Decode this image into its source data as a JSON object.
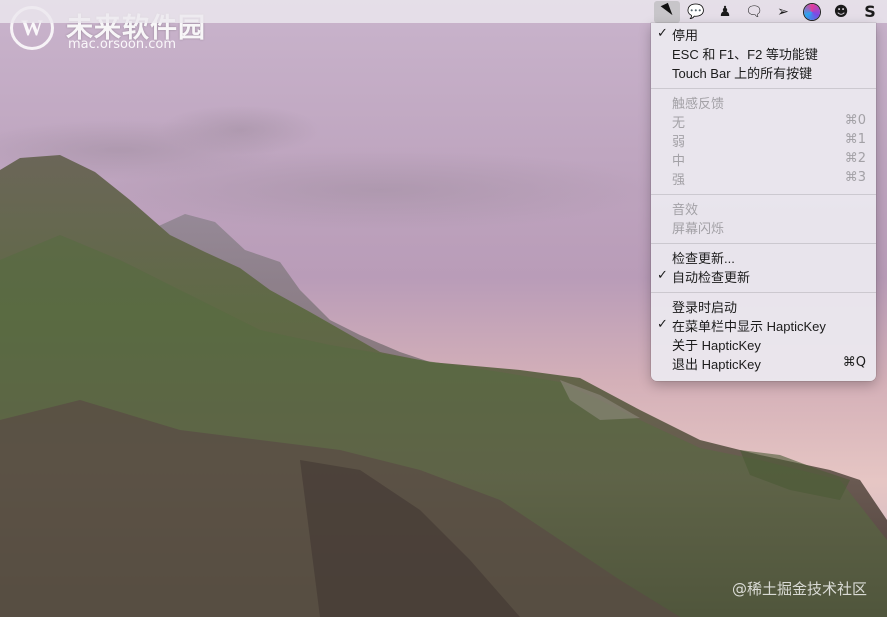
{
  "watermark": {
    "logo_letter": "W",
    "title": "未来软件园",
    "url": "mac.orsoon.com"
  },
  "menubar": {
    "status_icons": [
      {
        "name": "haptickey-cursor-icon",
        "glyph": ""
      },
      {
        "name": "wechat-icon",
        "glyph": "💬"
      },
      {
        "name": "qq-penguin-icon",
        "glyph": "♟"
      },
      {
        "name": "chat-bubble-icon",
        "glyph": "🗨"
      },
      {
        "name": "telegram-plane-icon",
        "glyph": "➢"
      },
      {
        "name": "siri-icon",
        "glyph": ""
      },
      {
        "name": "mask-face-icon",
        "glyph": "☻"
      },
      {
        "name": "s-logo-icon",
        "glyph": "S"
      }
    ]
  },
  "menu": {
    "disable_label": "停用",
    "esc_keys_label": "ESC 和 F1、F2 等功能键",
    "touchbar_keys_label": "Touch Bar 上的所有按键",
    "haptic_header": "触感反馈",
    "none_label": "无",
    "none_shortcut": "⌘0",
    "weak_label": "弱",
    "weak_shortcut": "⌘1",
    "medium_label": "中",
    "medium_shortcut": "⌘2",
    "strong_label": "强",
    "strong_shortcut": "⌘3",
    "sound_label": "音效",
    "screen_flash_label": "屏幕闪烁",
    "check_updates_label": "检查更新...",
    "auto_check_label": "自动检查更新",
    "launch_login_label": "登录时启动",
    "show_menubar_label": "在菜单栏中显示 HapticKey",
    "about_label": "关于 HapticKey",
    "quit_label": "退出 HapticKey",
    "quit_shortcut": "⌘Q",
    "checkmark": "✓"
  },
  "corner_watermark": "@稀土掘金技术社区"
}
